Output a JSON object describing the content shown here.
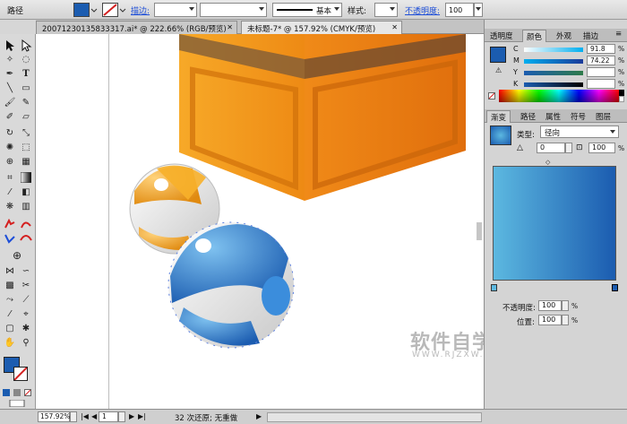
{
  "control_bar": {
    "object_type": "路径",
    "stroke_label": "描边:",
    "brush_label": "基本",
    "style_label": "样式:",
    "opacity_label": "不透明度:",
    "opacity_value": "100"
  },
  "doc_tabs": [
    {
      "label": "20071230135833317.ai* @ 222.66% (RGB/预览)"
    },
    {
      "label": "未标题-7* @ 157.92% (CMYK/预览)"
    }
  ],
  "color_panel": {
    "tabs": [
      "透明度",
      "颜色",
      "外观",
      "描边"
    ],
    "active_tab": "颜色",
    "channels": [
      {
        "label": "C",
        "value": "91.8"
      },
      {
        "label": "M",
        "value": "74.22"
      },
      {
        "label": "Y",
        "value": ""
      },
      {
        "label": "K",
        "value": ""
      }
    ],
    "pct": "%"
  },
  "gradient_panel": {
    "tabs": [
      "渐变",
      "路径",
      "属性",
      "符号",
      "图层"
    ],
    "active_tab": "渐变",
    "type_label": "类型:",
    "type_value": "径向",
    "angle_value": "0",
    "ratio_value": "100",
    "ratio_pct": "%",
    "opacity_label": "不透明度:",
    "opacity_value": "100",
    "position_label": "位置:",
    "position_value": "100",
    "pct": "%",
    "gradient_start": "#5cb8e0",
    "gradient_end": "#1b5cb0"
  },
  "status_bar": {
    "zoom": "157.92%",
    "page": "1",
    "status_text": "32 次还原; 无重做"
  },
  "watermark": {
    "line1": "软件自学网",
    "line2": "WWW.RJZXW.COM"
  },
  "colors": {
    "box_front": "#f39a1c",
    "box_side": "#e67a10",
    "ball_blue": "#2f7fd0",
    "ball_orange": "#f4a320",
    "fill_swatch": "#1b5cb0",
    "stroke_swatch_slash": "#d42020"
  }
}
